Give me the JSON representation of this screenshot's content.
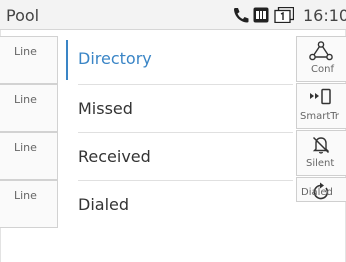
{
  "status_bar": {
    "title": "Pool",
    "time": "16:10",
    "icons": [
      "phone-handset-icon",
      "voicemail-icon",
      "line-1-icon"
    ]
  },
  "line_keys": [
    {
      "label": "Line"
    },
    {
      "label": "Line"
    },
    {
      "label": "Line"
    },
    {
      "label": "Line"
    }
  ],
  "menu": {
    "selected": "Directory",
    "items": [
      {
        "label": "Directory"
      },
      {
        "label": "Missed"
      },
      {
        "label": "Received"
      },
      {
        "label": "Dialed"
      }
    ]
  },
  "soft_keys": [
    {
      "label": "Conf",
      "icon": "conference-icon"
    },
    {
      "label": "SmartTr",
      "icon": "smart-transfer-icon"
    },
    {
      "label": "Silent",
      "icon": "silent-bell-icon"
    },
    {
      "label": "Dialed",
      "icon": "redial-icon"
    }
  ],
  "colors": {
    "accent": "#3a85c6",
    "status_bar_bg": "#f3f3f3"
  }
}
